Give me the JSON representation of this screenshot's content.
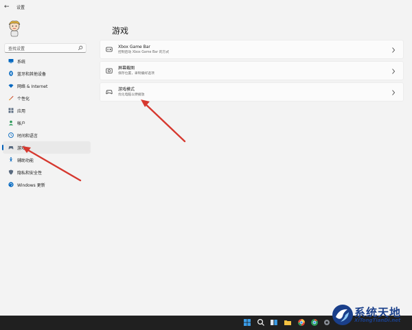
{
  "window": {
    "title": "设置",
    "back_icon": "back-arrow-icon"
  },
  "sidebar": {
    "search_placeholder": "查找设置",
    "items": [
      {
        "label": "系统",
        "icon": "monitor-icon",
        "color": "#0067c0"
      },
      {
        "label": "蓝牙和其他设备",
        "icon": "bluetooth-icon",
        "color": "#0067c0"
      },
      {
        "label": "网络 & Internet",
        "icon": "wifi-icon",
        "color": "#0067c0"
      },
      {
        "label": "个性化",
        "icon": "brush-icon",
        "color": "#d0593b"
      },
      {
        "label": "应用",
        "icon": "apps-icon",
        "color": "#5a6b80"
      },
      {
        "label": "帐户",
        "icon": "account-icon",
        "color": "#2d9a5a"
      },
      {
        "label": "时间和语言",
        "icon": "globe-clock-icon",
        "color": "#0067c0"
      },
      {
        "label": "游戏",
        "icon": "gamepad-icon",
        "color": "#5a6b80",
        "active": true
      },
      {
        "label": "辅助功能",
        "icon": "accessibility-icon",
        "color": "#0067c0"
      },
      {
        "label": "隐私和安全性",
        "icon": "shield-icon",
        "color": "#5a6b80"
      },
      {
        "label": "Windows 更新",
        "icon": "update-icon",
        "color": "#0067c0"
      }
    ]
  },
  "main": {
    "title": "游戏",
    "cards": [
      {
        "title": "Xbox Game Bar",
        "subtitle": "控制启动 Xbox Game Bar 的方式",
        "icon": "game-bar-icon"
      },
      {
        "title": "屏幕截图",
        "subtitle": "保存位置，录制偏好选项",
        "icon": "capture-icon"
      },
      {
        "title": "游戏模式",
        "subtitle": "优化电脑以便播放",
        "icon": "game-mode-icon"
      }
    ]
  },
  "watermark": {
    "title": "系统天地",
    "url": "XiTongTianDi.net"
  },
  "colors": {
    "accent": "#005fb8",
    "annotation_arrow": "#d6382f",
    "taskbar": "#202020"
  }
}
